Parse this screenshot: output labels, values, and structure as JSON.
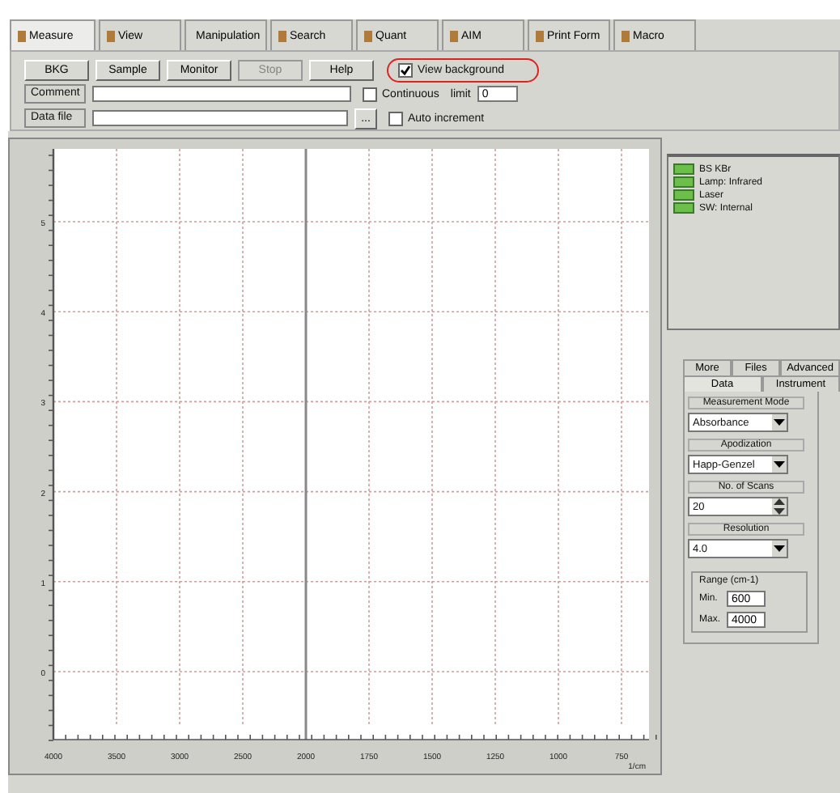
{
  "tabs": [
    {
      "label": "Measure",
      "selected": true
    },
    {
      "label": "View",
      "selected": false
    },
    {
      "label": "Manipulation",
      "selected": false
    },
    {
      "label": "Search",
      "selected": false
    },
    {
      "label": "Quant",
      "selected": false
    },
    {
      "label": "AIM",
      "selected": false
    },
    {
      "label": "Print Form",
      "selected": false
    },
    {
      "label": "Macro",
      "selected": false
    }
  ],
  "toolbar": {
    "buttons": [
      {
        "label": "BKG",
        "disabled": false
      },
      {
        "label": "Sample",
        "disabled": false
      },
      {
        "label": "Monitor",
        "disabled": false
      },
      {
        "label": "Stop",
        "disabled": true
      },
      {
        "label": "Help",
        "disabled": false
      }
    ],
    "view_background": {
      "label": "View background",
      "checked": true,
      "highlighted": true
    },
    "comment": {
      "label": "Comment"
    },
    "continuous": {
      "label": "Continuous",
      "checked": false
    },
    "limit": {
      "label": "limit",
      "value": "0"
    },
    "data_file": {
      "label": "Data file",
      "browse": "..."
    },
    "auto_increment": {
      "label": "Auto increment",
      "checked": false
    }
  },
  "plot": {
    "yticks": [
      "5",
      "4",
      "3",
      "2",
      "1",
      "0"
    ],
    "xticks": [
      "4000",
      "3500",
      "3000",
      "2500",
      "2000",
      "1750",
      "1500",
      "1250",
      "1000",
      "750"
    ],
    "xunit": "1/cm"
  },
  "status": [
    {
      "label": "BS KBr",
      "color": "#6cc04a"
    },
    {
      "label": "Lamp: Infrared",
      "color": "#6cc04a"
    },
    {
      "label": "Laser",
      "color": "#6cc04a"
    },
    {
      "label": "SW: Internal",
      "color": "#6cc04a"
    }
  ],
  "settings": {
    "tab_rows": [
      [
        {
          "label": "More",
          "selected": false
        },
        {
          "label": "Files",
          "selected": false
        },
        {
          "label": "Advanced",
          "selected": false
        }
      ],
      [
        {
          "label": "Data",
          "selected": true
        },
        {
          "label": "Instrument",
          "selected": false
        }
      ]
    ],
    "fields": [
      {
        "kind": "select",
        "label": "Measurement Mode",
        "value": "Absorbance"
      },
      {
        "kind": "select",
        "label": "Apodization",
        "value": "Happ-Genzel"
      },
      {
        "kind": "spin",
        "label": "No. of Scans",
        "value": "20"
      },
      {
        "kind": "select",
        "label": "Resolution",
        "value": "4.0"
      }
    ],
    "range": {
      "label": "Range (cm-1)",
      "min_label": "Min.",
      "min": "600",
      "max_label": "Max.",
      "max": "4000"
    }
  }
}
